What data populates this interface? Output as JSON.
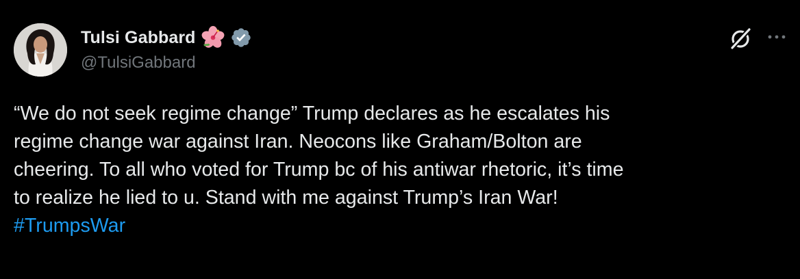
{
  "author": {
    "name": "Tulsi Gabbard",
    "handle": "@TulsiGabbard",
    "verified": true,
    "name_emoji": "hibiscus-icon",
    "badge_color": "#829aab"
  },
  "post": {
    "lines": [
      "“We do not seek regime change” Trump declares as he escalates his",
      "regime change war against Iran. Neocons like Graham/Bolton are",
      "cheering. To all who voted for Trump bc of his antiwar rhetoric, it’s time",
      "to realize he lied to u. Stand with me against Trump’s Iran War!"
    ],
    "hashtag": "#TrumpsWar"
  },
  "colors": {
    "background": "#000000",
    "text": "#e7e9ea",
    "muted": "#71767b",
    "link": "#1d9bf0"
  }
}
